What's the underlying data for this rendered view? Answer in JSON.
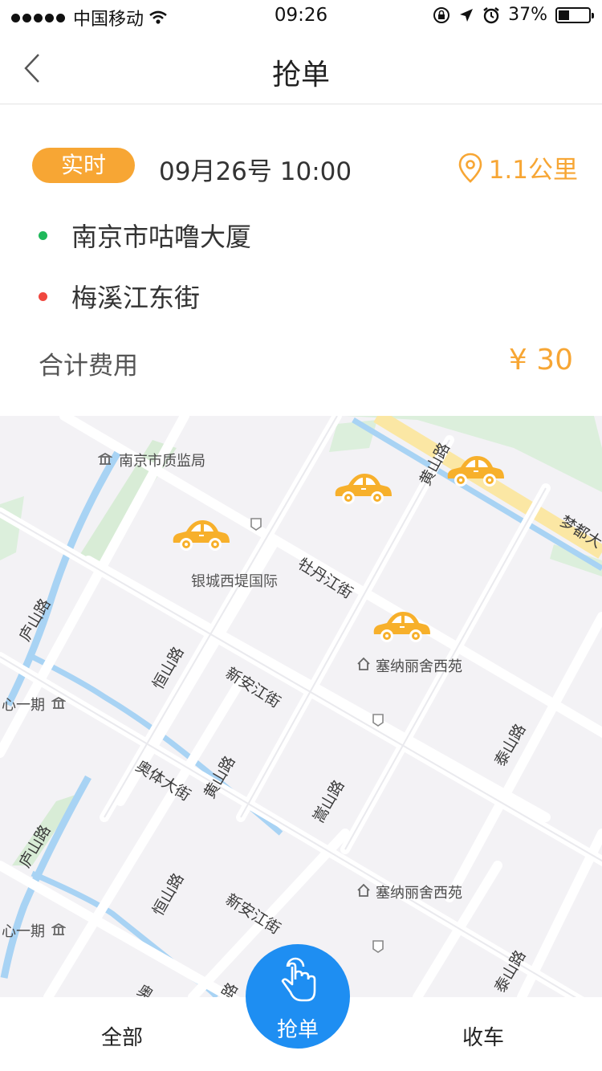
{
  "status_bar": {
    "carrier": "中国移动",
    "time": "09:26",
    "battery": "37%",
    "battery_level": 0.37
  },
  "nav": {
    "title": "抢单",
    "back_icon": "chevron-left-icon"
  },
  "order": {
    "badge": "实时",
    "time": "09月26号 10:00",
    "distance": "1.1公里",
    "from": "南京市咕噜大厦",
    "to": "梅溪江东街",
    "total_label": "合计费用",
    "total_price": "¥ 30"
  },
  "map": {
    "labels": {
      "quality_bureau": "南京市质监局",
      "yincheng": "银城西堤国际",
      "sainali_1": "塞纳丽舍西苑",
      "sainali_2": "塞纳丽舍西苑",
      "xinyiqi_1": "心一期",
      "xinyiqi_2": "心一期"
    },
    "roads": {
      "huangshan_top": "黄山路",
      "mengdu": "梦都大",
      "mudanjiang": "牡丹江街",
      "lushan_1": "庐山路",
      "hengshan_1": "恒山路",
      "xinanjiang_1": "新安江街",
      "aoti": "奥体大街",
      "huangshan_mid": "黄山路",
      "songshan": "嵩山路",
      "taishan_1": "泰山路",
      "lushan_2": "庐山路",
      "hengshan_2": "恒山路",
      "xinanjiang_2": "新安江街",
      "taishan_2": "泰山路",
      "ao_partial": "奥",
      "lu_partial": "路"
    },
    "car_color": "#f7b02b"
  },
  "tabs": {
    "all": "全部",
    "grab": "抢单",
    "close": "收车"
  },
  "colors": {
    "accent": "#f7a634",
    "primary": "#1e8ef2",
    "from_dot": "#1fb85a",
    "to_dot": "#f0473f"
  }
}
